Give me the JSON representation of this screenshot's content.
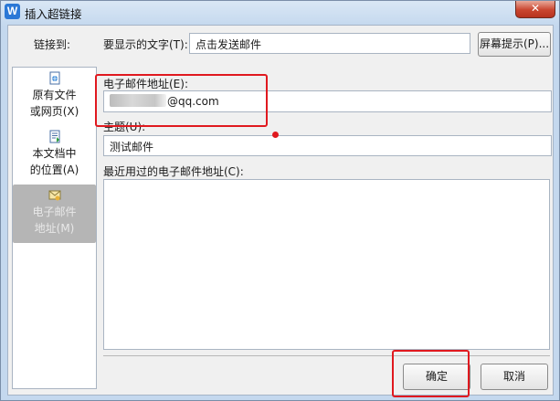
{
  "window": {
    "title": "插入超链接",
    "app_icon": "W"
  },
  "link_to_label": "链接到:",
  "display_text": {
    "label": "要显示的文字(T):",
    "value": "点击发送邮件"
  },
  "screen_tip_button": "屏幕提示(P)...",
  "sidebar": {
    "items": [
      {
        "line1": "原有文件",
        "line2": "或网页(X)",
        "icon": "file-web-icon"
      },
      {
        "line1": "本文档中",
        "line2": "的位置(A)",
        "icon": "document-place-icon"
      },
      {
        "line1": "电子邮件",
        "line2": "地址(M)",
        "icon": "email-icon",
        "selected": true
      }
    ]
  },
  "email": {
    "label": "电子邮件地址(E):",
    "value_suffix": "@qq.com"
  },
  "subject": {
    "label": "主题(U):",
    "value": "测试邮件"
  },
  "recent": {
    "label": "最近用过的电子邮件地址(C):"
  },
  "buttons": {
    "ok": "确定",
    "cancel": "取消"
  },
  "close_glyph": "✕",
  "annotation_color": "#e0191f"
}
